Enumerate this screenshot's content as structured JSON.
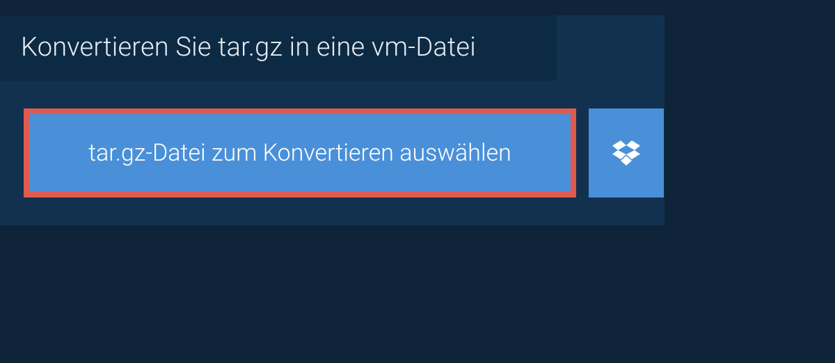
{
  "header": {
    "title": "Konvertieren Sie tar.gz in eine vm-Datei"
  },
  "actions": {
    "select_file_label": "tar.gz-Datei zum Konvertieren auswählen"
  },
  "colors": {
    "page_bg": "#0f2438",
    "panel_bg": "#11314f",
    "header_bg": "#0d2a44",
    "button_bg": "#4a90d9",
    "button_border": "#e05a4f",
    "text_light": "#e7edf2"
  }
}
